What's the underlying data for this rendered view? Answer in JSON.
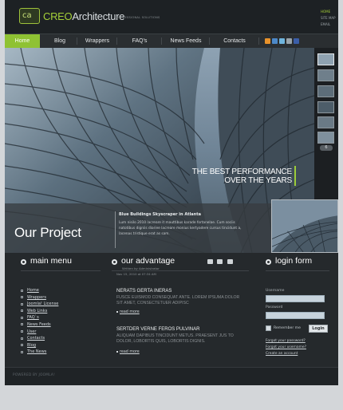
{
  "brand": {
    "badge": "ca",
    "name_part1": "CREO",
    "name_part2": "Architecture",
    "tagline": "PROFESSIONAL SOLUTIONS"
  },
  "top_links": [
    "HOME",
    "SITE MAP",
    "EMAIL"
  ],
  "nav": {
    "items": [
      "Home",
      "Blog",
      "Wrappers",
      "FAQ's",
      "News Feeds",
      "Contacts"
    ],
    "active_index": 0,
    "social_icons": [
      "rss-icon",
      "delicious-icon",
      "twitter-icon",
      "email-icon",
      "facebook-icon"
    ]
  },
  "hero": {
    "headline_line1": "THE BEST PERFORMANCE",
    "headline_line2": "OVER THE YEARS",
    "thumb_count_label": "6",
    "project_title": "Our Project",
    "project_heading": "Blue Buildings Skyscraper in Atlanta",
    "project_text": "Lum nisilo 2010 lacreare it mauttibus karade fortanelae. Cum sociis natotibus digniis dioriee lacreare monius kertyadere cursus tincidunt a, lacenas tristique erat as sam."
  },
  "sections": {
    "menu_title": "main menu",
    "advantage_title": "our advantage",
    "login_title": "login form"
  },
  "menu": [
    "Home",
    "Wrappers",
    "Joomla! License",
    "Web Links",
    "FAQ`s",
    "News Feeds",
    "User",
    "Contacts",
    "Blog",
    "The News"
  ],
  "advantage": {
    "meta_author": "Written by Administrator",
    "meta_date": "Nov 15, 2010 at 07:34 AM",
    "articles": [
      {
        "title": "NERATS GERTA INERAS",
        "text": "FUSCE EUISMOD CONSEQUAT ANTE. LOREM IPSUMA DOLOR SIT AMET, CONSECTETUER ADIPISC",
        "more": "read more"
      },
      {
        "title": "SERTDER VERNE FEROS PULVINAR",
        "text": "ALIQUAM DAPIBUS TINCIDUNT METUS. PRAESENT JUS TO DOLOR, LOBORTIS QUIS, LOBORTIS DIGNIS.",
        "more": "read more"
      }
    ]
  },
  "login": {
    "username_label": "Username",
    "password_label": "Password",
    "remember_label": "Remember me",
    "button": "Login",
    "links": [
      "Forgot your password?",
      "Forgot your username?",
      "Create an account"
    ]
  },
  "footer": {
    "powered": "POWERED BY JOOMLA!"
  },
  "colors": {
    "accent": "#8fc233",
    "background": "#25292c",
    "page_bg": "#d3d6d9"
  }
}
